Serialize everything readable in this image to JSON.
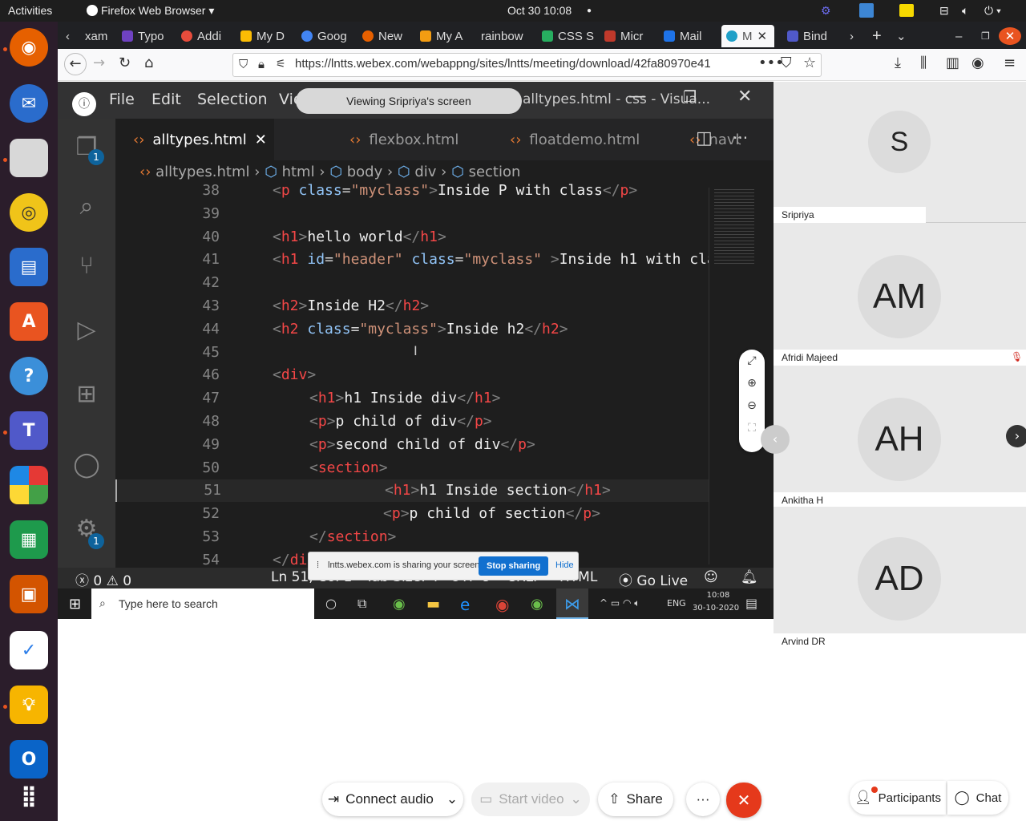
{
  "topbar": {
    "activities": "Activities",
    "app": "Firefox Web Browser",
    "clock": "Oct 30  10:08"
  },
  "tabs": [
    "xam",
    "Typo",
    "Addi",
    "My D",
    "Goog",
    "New",
    "My A",
    "rainbow",
    "CSS S",
    "Micr",
    "Mail",
    "M",
    "Bind"
  ],
  "url": "https://lntts.webex.com/webappng/sites/lntts/meeting/download/42fa80970e41",
  "vscode": {
    "menu": [
      "File",
      "Edit",
      "Selection",
      "View"
    ],
    "title": "alltypes.html - css - Visua...",
    "viewing": "Viewing Sripriya's screen",
    "tabs": [
      "alltypes.html",
      "flexbox.html",
      "floatdemo.html",
      "navb"
    ],
    "crumbs": [
      "alltypes.html",
      "html",
      "body",
      "div",
      "section"
    ],
    "explorer_badge": "1",
    "settings_badge": "1",
    "lines": [
      {
        "n": "38",
        "code": "<p class=\"myclass\">Inside P with class</p>"
      },
      {
        "n": "39",
        "code": ""
      },
      {
        "n": "40",
        "code": "<h1>hello world</h1>"
      },
      {
        "n": "41",
        "code": "<h1 id=\"header\" class=\"myclass\" >Inside h1 with cla"
      },
      {
        "n": "42",
        "code": ""
      },
      {
        "n": "43",
        "code": "<h2>Inside H2</h2>"
      },
      {
        "n": "44",
        "code": "<h2 class=\"myclass\">Inside h2</h2>"
      },
      {
        "n": "45",
        "code": ""
      },
      {
        "n": "46",
        "code": "<div>"
      },
      {
        "n": "47",
        "code": "<h1>h1 Inside div</h1>"
      },
      {
        "n": "48",
        "code": "<p>p child of div</p>"
      },
      {
        "n": "49",
        "code": "<p>second child of div</p>"
      },
      {
        "n": "50",
        "code": "<section>"
      },
      {
        "n": "51",
        "code": "<h1>h1 Inside section</h1>"
      },
      {
        "n": "52",
        "code": "<p>p child of section</p>"
      },
      {
        "n": "53",
        "code": "</section>"
      },
      {
        "n": "54",
        "code": "</div>"
      }
    ],
    "status": {
      "errors": "0",
      "warnings": "0",
      "position": "Ln 51, Col 1",
      "tabsize": "Tab Size: 4",
      "encoding": "UTF-8",
      "eol": "CRLF",
      "lang": "HTML",
      "golive": "Go Live"
    },
    "sharing_bar": {
      "text": "lntts.webex.com is sharing your screen.",
      "stop": "Stop sharing",
      "hide": "Hide"
    },
    "win_taskbar": {
      "search_placeholder": "Type here to search",
      "lang": "ENG",
      "time": "10:08",
      "date": "30-10-2020"
    }
  },
  "participants": [
    {
      "initials": "S",
      "name": "Sripriya"
    },
    {
      "initials": "AM",
      "name": "Afridi Majeed"
    },
    {
      "initials": "AH",
      "name": "Ankitha H"
    },
    {
      "initials": "AD",
      "name": "Arvind DR"
    }
  ],
  "controls": {
    "audio": "Connect audio",
    "video": "Start video",
    "share": "Share",
    "participants": "Participants",
    "chat": "Chat"
  },
  "colors": {
    "dock_bg": "#2b1d2b",
    "vscode_bg": "#1e1e1e",
    "end_button": "#e5391b",
    "share_blue": "#1170cf"
  }
}
